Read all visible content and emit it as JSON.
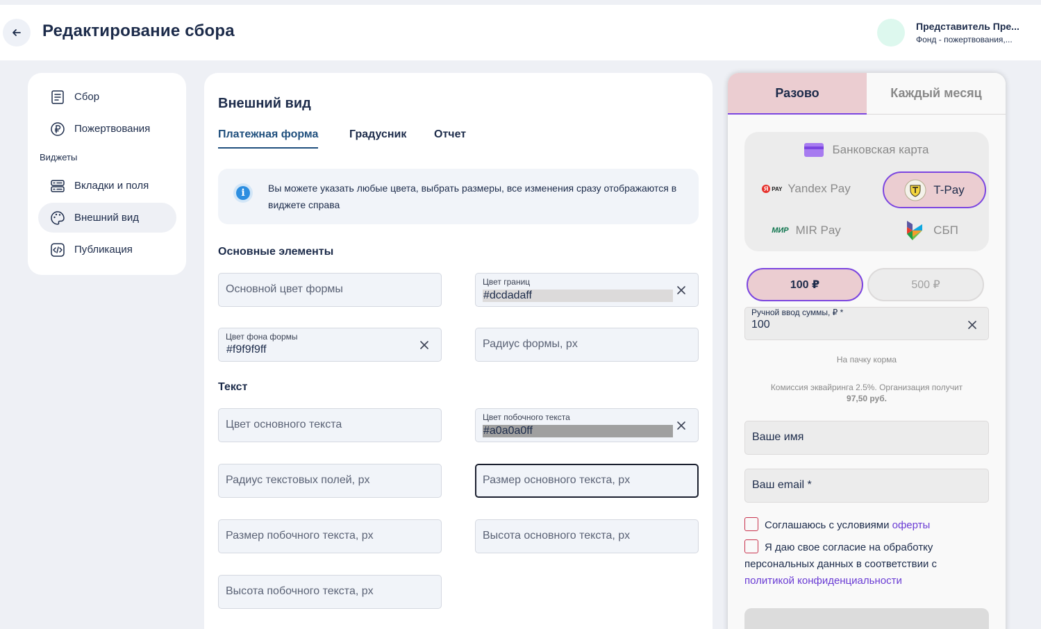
{
  "header": {
    "title": "Редактирование сбора",
    "user_name": "Представитель Пре...",
    "user_org": "Фонд - пожертвования,..."
  },
  "sidebar": {
    "items": [
      {
        "label": "Сбор",
        "icon": "receipt-icon"
      },
      {
        "label": "Пожертвования",
        "icon": "ruble-icon"
      },
      {
        "label": "Вкладки и поля",
        "icon": "layout-icon"
      },
      {
        "label": "Внешний вид",
        "icon": "palette-icon"
      },
      {
        "label": "Публикация",
        "icon": "code-icon"
      }
    ],
    "section_widgets": "Виджеты",
    "active": "Внешний вид"
  },
  "main": {
    "title": "Внешний вид",
    "tabs": [
      {
        "label": "Платежная форма",
        "active": true
      },
      {
        "label": "Градусник",
        "active": false
      },
      {
        "label": "Отчет",
        "active": false
      }
    ],
    "info_text": "Вы можете указать любые цвета, выбрать размеры, все изменения сразу отображаются в виджете справа",
    "section_main": "Основные элементы",
    "section_text": "Текст",
    "fields": {
      "main_color": {
        "placeholder": "Основной цвет формы"
      },
      "border_color": {
        "label": "Цвет границ",
        "value": "#dcdadaff"
      },
      "bg_color": {
        "label": "Цвет фона формы",
        "value": "#f9f9f9ff"
      },
      "form_radius": {
        "placeholder": "Радиус формы, px"
      },
      "main_text_color": {
        "placeholder": "Цвет основного текста"
      },
      "side_text_color": {
        "label": "Цвет побочного текста",
        "value": "#a0a0a0ff"
      },
      "input_radius": {
        "placeholder": "Радиус текстовых полей, px"
      },
      "main_text_size": {
        "placeholder": "Размер основного текста, px"
      },
      "side_text_size": {
        "placeholder": "Размер побочного текста, px"
      },
      "main_text_height": {
        "placeholder": "Высота основного текста, px"
      },
      "side_text_height": {
        "placeholder": "Высота побочного текста, px"
      }
    }
  },
  "widget": {
    "tabs": {
      "once": "Разово",
      "monthly": "Каждый месяц"
    },
    "payment": {
      "card": "Банковская карта",
      "yandex": "Yandex Pay",
      "yandex_badge": "PAY",
      "tpay": "T-Pay",
      "mir": "MIR Pay",
      "mir_badge": "МИР",
      "sbp": "СБП",
      "selected": "T-Pay"
    },
    "amounts": [
      "100 ₽",
      "500 ₽"
    ],
    "manual": {
      "label": "Ручной ввод суммы, ₽ *",
      "value": "100"
    },
    "purpose": "На пачку корма",
    "commission_line1": "Комиссия эквайринга 2.5%. Организация получит",
    "commission_line2": "97,50 руб.",
    "name_placeholder": "Ваше имя",
    "email_placeholder": "Ваш email *",
    "agree_prefix": "Соглашаюсь с условиями",
    "agree_link": "оферты",
    "consent_prefix": "Я даю свое согласие на обработку персональных данных в соответствии с",
    "consent_link": "политикой конфиденциальности"
  },
  "colors": {
    "accent": "#7b45e0",
    "selected_bg": "#ebcdd1",
    "checkbox_border": "#c8324d",
    "primary_text": "#1c2b4a"
  }
}
